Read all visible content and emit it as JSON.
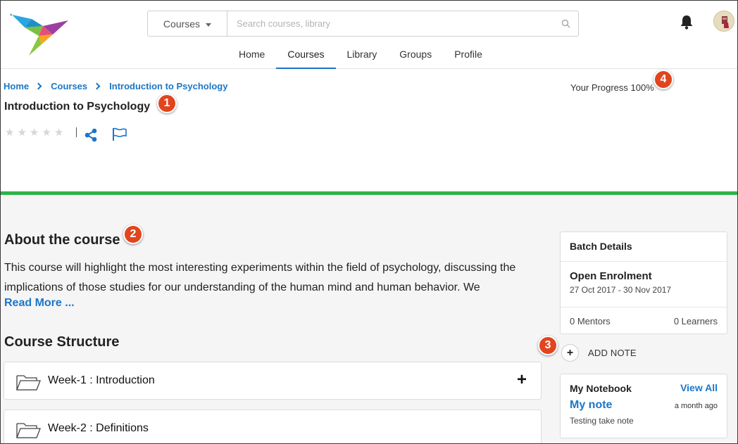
{
  "header": {
    "search": {
      "scope": "Courses",
      "placeholder": "Search courses, library"
    },
    "nav": [
      {
        "label": "Home"
      },
      {
        "label": "Courses",
        "active": true
      },
      {
        "label": "Library"
      },
      {
        "label": "Groups"
      },
      {
        "label": "Profile"
      }
    ]
  },
  "breadcrumb": [
    "Home",
    "Courses",
    "Introduction to Psychology"
  ],
  "course": {
    "title": "Introduction to Psychology",
    "progress_text": "Your Progress 100%",
    "rating": 0
  },
  "about": {
    "title": "About the course",
    "text": "This course will highlight the most interesting experiments within the field of psychology, discussing the implications of those studies for our understanding of the human mind and human behavior. We",
    "read_more": "Read More ..."
  },
  "structure": {
    "title": "Course Structure",
    "weeks": [
      {
        "label": "Week-1 : Introduction",
        "expand": "+"
      },
      {
        "label": "Week-2 : Definitions"
      }
    ]
  },
  "batch": {
    "title": "Batch Details",
    "name": "Open Enrolment",
    "dates": "27 Oct 2017 - 30 Nov 2017",
    "mentors": "0 Mentors",
    "learners": "0 Learners"
  },
  "add_note": {
    "label": "ADD NOTE"
  },
  "notebook": {
    "title": "My Notebook",
    "view_all": "View All",
    "note_title": "My note",
    "note_time": "a month ago",
    "note_desc": "Testing take note"
  },
  "callouts": [
    "1",
    "2",
    "3",
    "4"
  ],
  "colors": {
    "accent": "#1b76c7",
    "progress_bar": "#2db34a",
    "callout": "#e2441d"
  },
  "icons": [
    "logo-bird-icon",
    "search-icon",
    "bell-icon",
    "avatar",
    "chevron-right-icon",
    "star-icon",
    "share-icon",
    "flag-icon",
    "folder-icon",
    "plus-icon"
  ]
}
